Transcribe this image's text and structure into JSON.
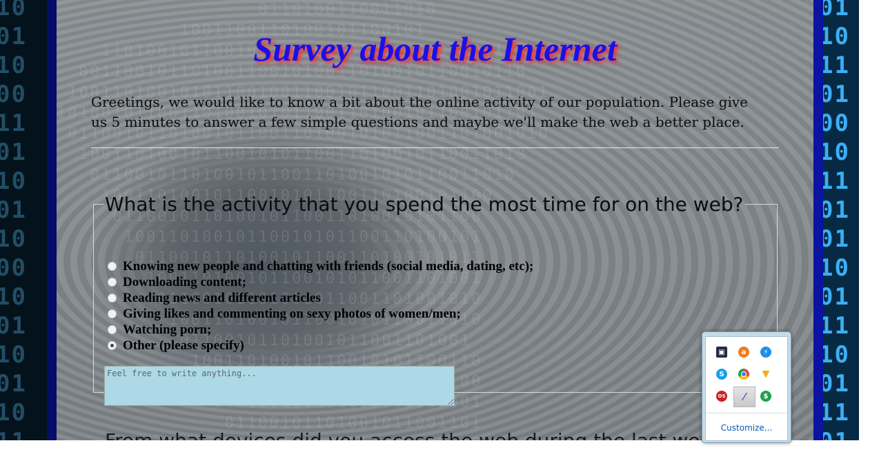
{
  "page": {
    "title": "Survey about the Internet",
    "intro": "Greetings, we would like to know a bit about the online activity of our population. Please give us 5 minutes to answer a few simple questions and maybe we'll make the web a better place."
  },
  "question1": {
    "legend": "What is the activity that you spend the most time for on the web?",
    "options": [
      "Knowing new people and chatting with friends (social media, dating, etc);",
      "Downloading content;",
      "Reading news and different articles",
      "Giving likes and commenting on sexy photos of women/men;",
      "Watching porn;",
      "Other (please specify)"
    ],
    "selected_index": 5,
    "textarea_placeholder": "Feel free to write anything..."
  },
  "question2": {
    "legend": "From what devices did you access the web during the last week?"
  },
  "tray": {
    "icons": [
      {
        "name": "monitor-tray-icon",
        "color": "#222c44"
      },
      {
        "name": "avast-icon",
        "color": "#f47920"
      },
      {
        "name": "lightning-icon",
        "color": "#1e90e8"
      },
      {
        "name": "skype-icon",
        "color": "#1aa0e8"
      },
      {
        "name": "chrome-icon",
        "color": "#de4b39"
      },
      {
        "name": "sweater-icon",
        "color": "#f2b010"
      },
      {
        "name": "lastpass-icon",
        "color": "#cc2020"
      },
      {
        "name": "pen-icon",
        "color": "#8a3cc8"
      },
      {
        "name": "dollar-icon",
        "color": "#21a04a"
      }
    ],
    "customize_label": "Customize..."
  },
  "colors": {
    "title": "#1a10e8",
    "title_shadow": "#ff2a2a",
    "textarea_bg": "#add8e6",
    "frame": "#060d66"
  }
}
